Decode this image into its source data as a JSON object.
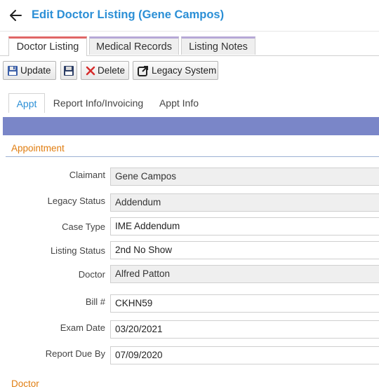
{
  "header": {
    "title": "Edit Doctor Listing (Gene Campos)"
  },
  "top_tabs": [
    "Doctor Listing",
    "Medical Records",
    "Listing Notes"
  ],
  "toolbar": {
    "update": "Update",
    "delete": "Delete",
    "legacy": "Legacy System"
  },
  "sub_tabs": [
    "Appt",
    "Report Info/Invoicing",
    "Appt Info"
  ],
  "section": {
    "title": "Appointment",
    "next_title": "Doctor"
  },
  "fields": {
    "claimant": {
      "label": "Claimant",
      "value": "Gene Campos"
    },
    "legacy_status": {
      "label": "Legacy Status",
      "value": "Addendum"
    },
    "case_type": {
      "label": "Case Type",
      "value": "IME Addendum"
    },
    "listing_status": {
      "label": "Listing Status",
      "value": "2nd No Show"
    },
    "doctor": {
      "label": "Doctor",
      "value": "Alfred Patton"
    },
    "bill": {
      "label": "Bill #",
      "value": "CKHN59"
    },
    "exam_date": {
      "label": "Exam Date",
      "value": "03/20/2021"
    },
    "report_due": {
      "label": "Report Due By",
      "value": "07/09/2020"
    }
  },
  "colors": {
    "accent": "#2b8fd6",
    "section": "#e07d10",
    "banner": "#7a86c8"
  }
}
